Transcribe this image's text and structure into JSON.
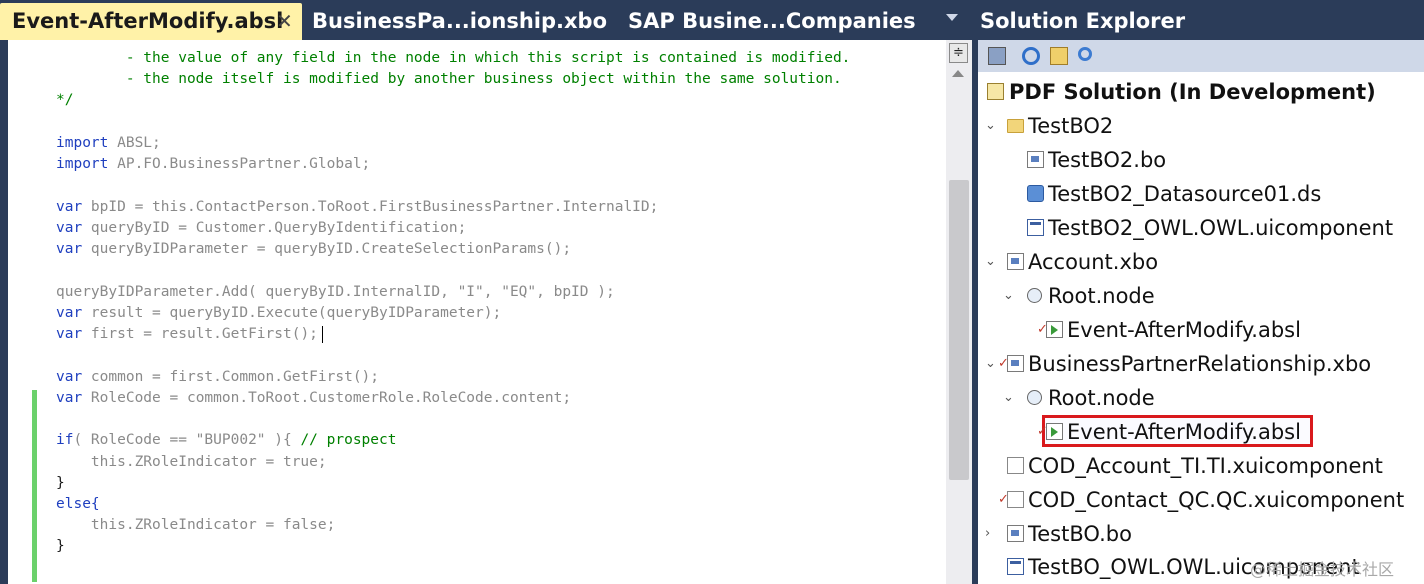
{
  "tabs": [
    {
      "label": "Event-AfterModify.absl",
      "active": true
    },
    {
      "label": "BusinessPa...ionship.xbo",
      "active": false
    },
    {
      "label": "SAP Busine...Companies",
      "active": false
    }
  ],
  "tab_close_symbol": "✕",
  "code_lines": [
    "        - the value of any field in the node in which this script is contained is modified.",
    "        - the node itself is modified by another business object within the same solution.",
    "*/",
    "import ABSL;",
    "import AP.FO.BusinessPartner.Global;",
    "var bpID = this.ContactPerson.ToRoot.FirstBusinessPartner.InternalID;",
    "var queryByID = Customer.QueryByIdentification;",
    "var queryByIDParameter = queryByID.CreateSelectionParams();",
    "queryByIDParameter.Add( queryByID.InternalID, \"I\", \"EQ\", bpID );",
    "var result = queryByID.Execute(queryByIDParameter);",
    "var first = result.GetFirst();",
    "var common = first.Common.GetFirst();",
    "var RoleCode = common.ToRoot.CustomerRole.RoleCode.content;",
    "if( RoleCode == \"BUP002\" ){ // prospect",
    "    this.ZRoleIndicator = true;",
    "}",
    "else{",
    "    this.ZRoleIndicator = false;",
    "}"
  ],
  "explorer": {
    "title": "Solution Explorer",
    "toolbar_icons": [
      "properties-icon",
      "refresh-icon",
      "show-all-files-icon",
      "find-icon"
    ],
    "items": [
      {
        "label": "PDF Solution (In Development)",
        "icon": "solution-icon"
      },
      {
        "label": "TestBO2",
        "icon": "folder-icon"
      },
      {
        "label": "TestBO2.bo",
        "icon": "bo-file-icon"
      },
      {
        "label": "TestBO2_Datasource01.ds",
        "icon": "datasource-icon"
      },
      {
        "label": "TestBO2_OWL.OWL.uicomponent",
        "icon": "ui-component-icon"
      },
      {
        "label": "Account.xbo",
        "icon": "xbo-file-icon"
      },
      {
        "label": "Root.node",
        "icon": "node-icon"
      },
      {
        "label": "Event-AfterModify.absl",
        "icon": "script-icon"
      },
      {
        "label": "BusinessPartnerRelationship.xbo",
        "icon": "xbo-file-icon"
      },
      {
        "label": "Root.node",
        "icon": "node-icon"
      },
      {
        "label": "Event-AfterModify.absl",
        "icon": "script-icon",
        "selected": true
      },
      {
        "label": "COD_Account_TI.TI.xuicomponent",
        "icon": "blank-file-icon"
      },
      {
        "label": "COD_Contact_QC.QC.xuicomponent",
        "icon": "blank-file-icon"
      },
      {
        "label": "TestBO.bo",
        "icon": "bo-file-icon"
      },
      {
        "label": "TestBO_OWL.OWL.uicomponent",
        "icon": "ui-component-icon"
      }
    ]
  },
  "watermark": "@稀土掘金技术社区",
  "colors": {
    "title_bar": "#2b3c59",
    "active_tab": "#fff2a8",
    "change_bar": "#6bd16b",
    "selection_border": "#d9191c"
  }
}
